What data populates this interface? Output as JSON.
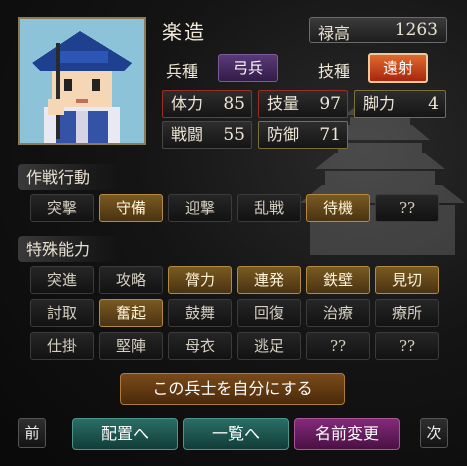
{
  "general": {
    "name": "楽造",
    "portrait_icon": "pixel-soldier-archer-portrait"
  },
  "info": {
    "salary_label": "禄高",
    "salary_value": "1263",
    "troop_type_label": "兵種",
    "troop_type_value": "弓兵",
    "skill_type_label": "技種",
    "skill_type_value": "遠射"
  },
  "stats": {
    "strength_label": "体力",
    "strength_value": "85",
    "skill_label": "技量",
    "skill_value": "97",
    "leg_label": "脚力",
    "leg_value": "4",
    "combat_label": "戦闘",
    "combat_value": "55",
    "defense_label": "防御",
    "defense_value": "71"
  },
  "tactics": {
    "title": "作戦行動",
    "buttons": [
      "突撃",
      "守備",
      "迎撃",
      "乱戦",
      "待機",
      "??"
    ],
    "active": [
      "守備",
      "待機"
    ]
  },
  "abilities": {
    "title": "特殊能力",
    "row1": [
      "突進",
      "攻略",
      "膂力",
      "連発",
      "鉄壁",
      "見切"
    ],
    "row2": [
      "討取",
      "奮起",
      "鼓舞",
      "回復",
      "治療",
      "療所"
    ],
    "row3": [
      "仕掛",
      "堅陣",
      "母衣",
      "逃足",
      "??",
      "??"
    ],
    "active": [
      "膂力",
      "連発",
      "鉄壁",
      "見切",
      "奮起"
    ]
  },
  "actions": {
    "make_own": "この兵士を自分にする",
    "prev": "前",
    "deploy": "配置へ",
    "list": "一覧へ",
    "rename": "名前変更",
    "next": "次"
  },
  "colors": {
    "active_gold": "#7a5a22",
    "troop_purple": "#4a2d62",
    "skill_red": "#d04a1c",
    "teal": "#1f5a55",
    "rename_purple": "#6a1f63"
  }
}
